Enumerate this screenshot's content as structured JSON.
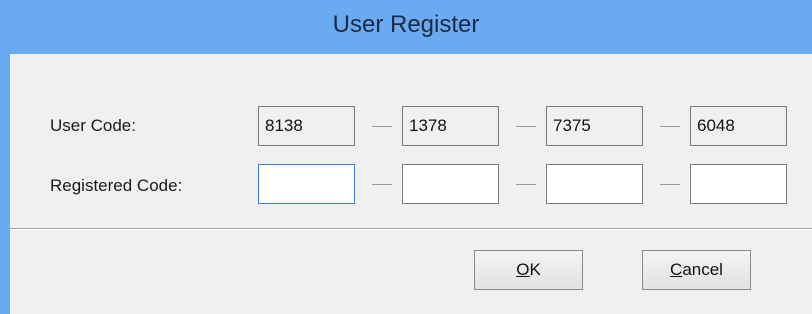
{
  "window": {
    "title": "User Register"
  },
  "user_code": {
    "label": "User Code:",
    "segments": [
      "8138",
      "1378",
      "7375",
      "6048"
    ]
  },
  "registered_code": {
    "label": "Registered Code:",
    "segments": [
      "",
      "",
      "",
      ""
    ]
  },
  "buttons": {
    "ok": {
      "mnemonic": "O",
      "rest": "K"
    },
    "cancel": {
      "mnemonic": "C",
      "rest": "ancel"
    }
  },
  "colors": {
    "titlebar": "#6aaaf0",
    "dialog_bg": "#f0f0f0",
    "focus_border": "#3c7fd1"
  }
}
